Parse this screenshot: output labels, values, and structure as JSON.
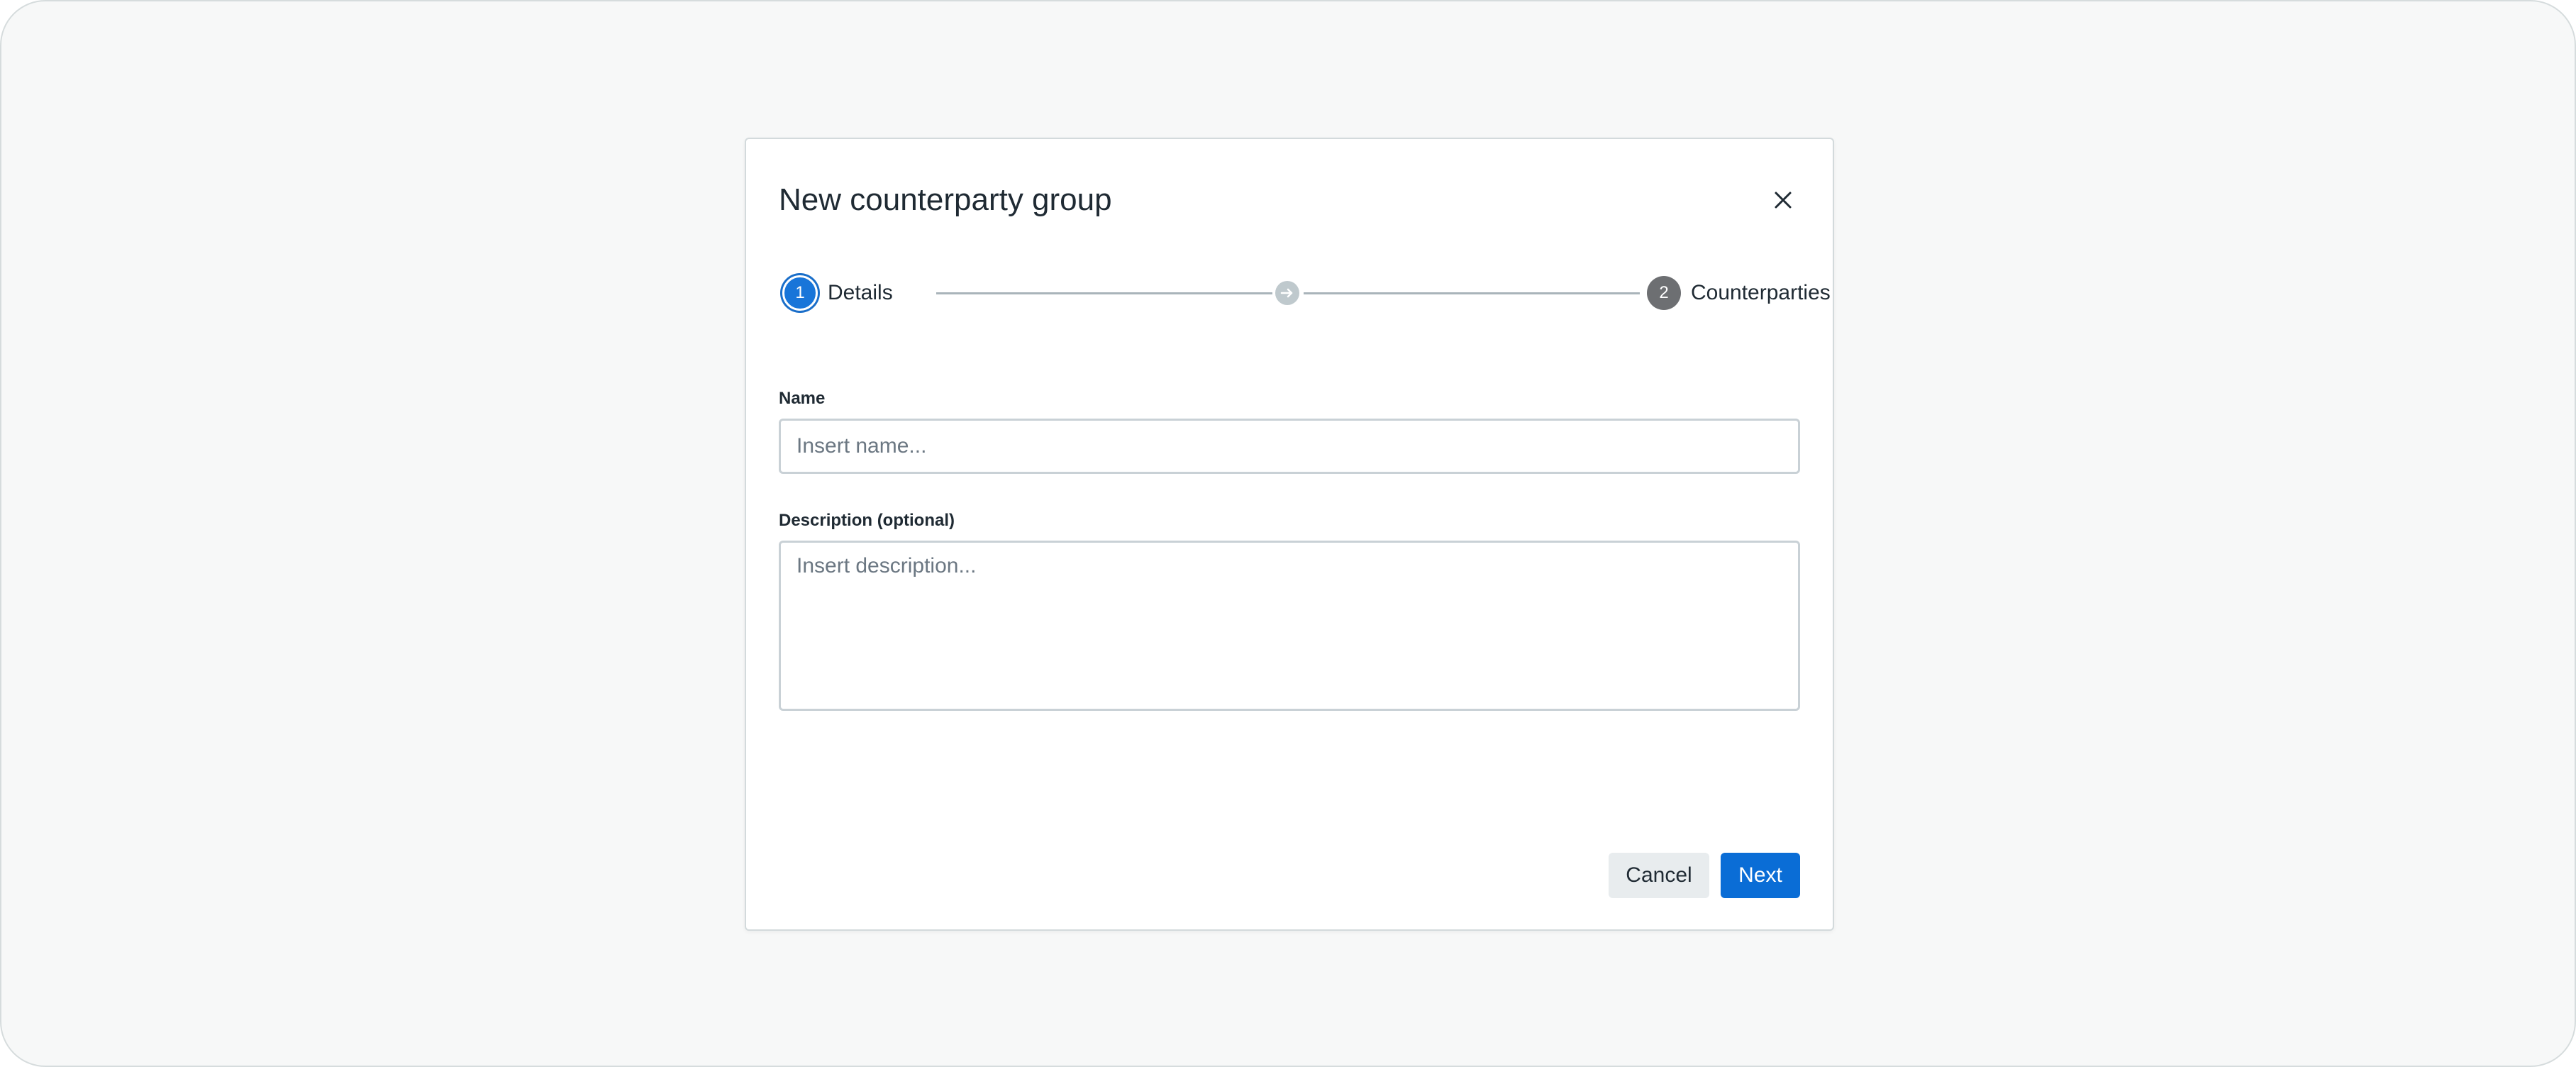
{
  "modal": {
    "title": "New counterparty group",
    "close_icon": "close-icon"
  },
  "stepper": {
    "steps": [
      {
        "number": "1",
        "label": "Details",
        "state": "active"
      },
      {
        "number": "2",
        "label": "Counterparties",
        "state": "inactive"
      }
    ],
    "connector_icon": "arrow-right-icon"
  },
  "form": {
    "name": {
      "label": "Name",
      "value": "",
      "placeholder": "Insert name..."
    },
    "description": {
      "label": "Description (optional)",
      "value": "",
      "placeholder": "Insert description..."
    }
  },
  "footer": {
    "cancel_label": "Cancel",
    "next_label": "Next"
  },
  "colors": {
    "primary": "#0a6dd6",
    "active_step": "#1875d9",
    "inactive_step": "#6d6f72",
    "background": "#f7f8f8"
  }
}
